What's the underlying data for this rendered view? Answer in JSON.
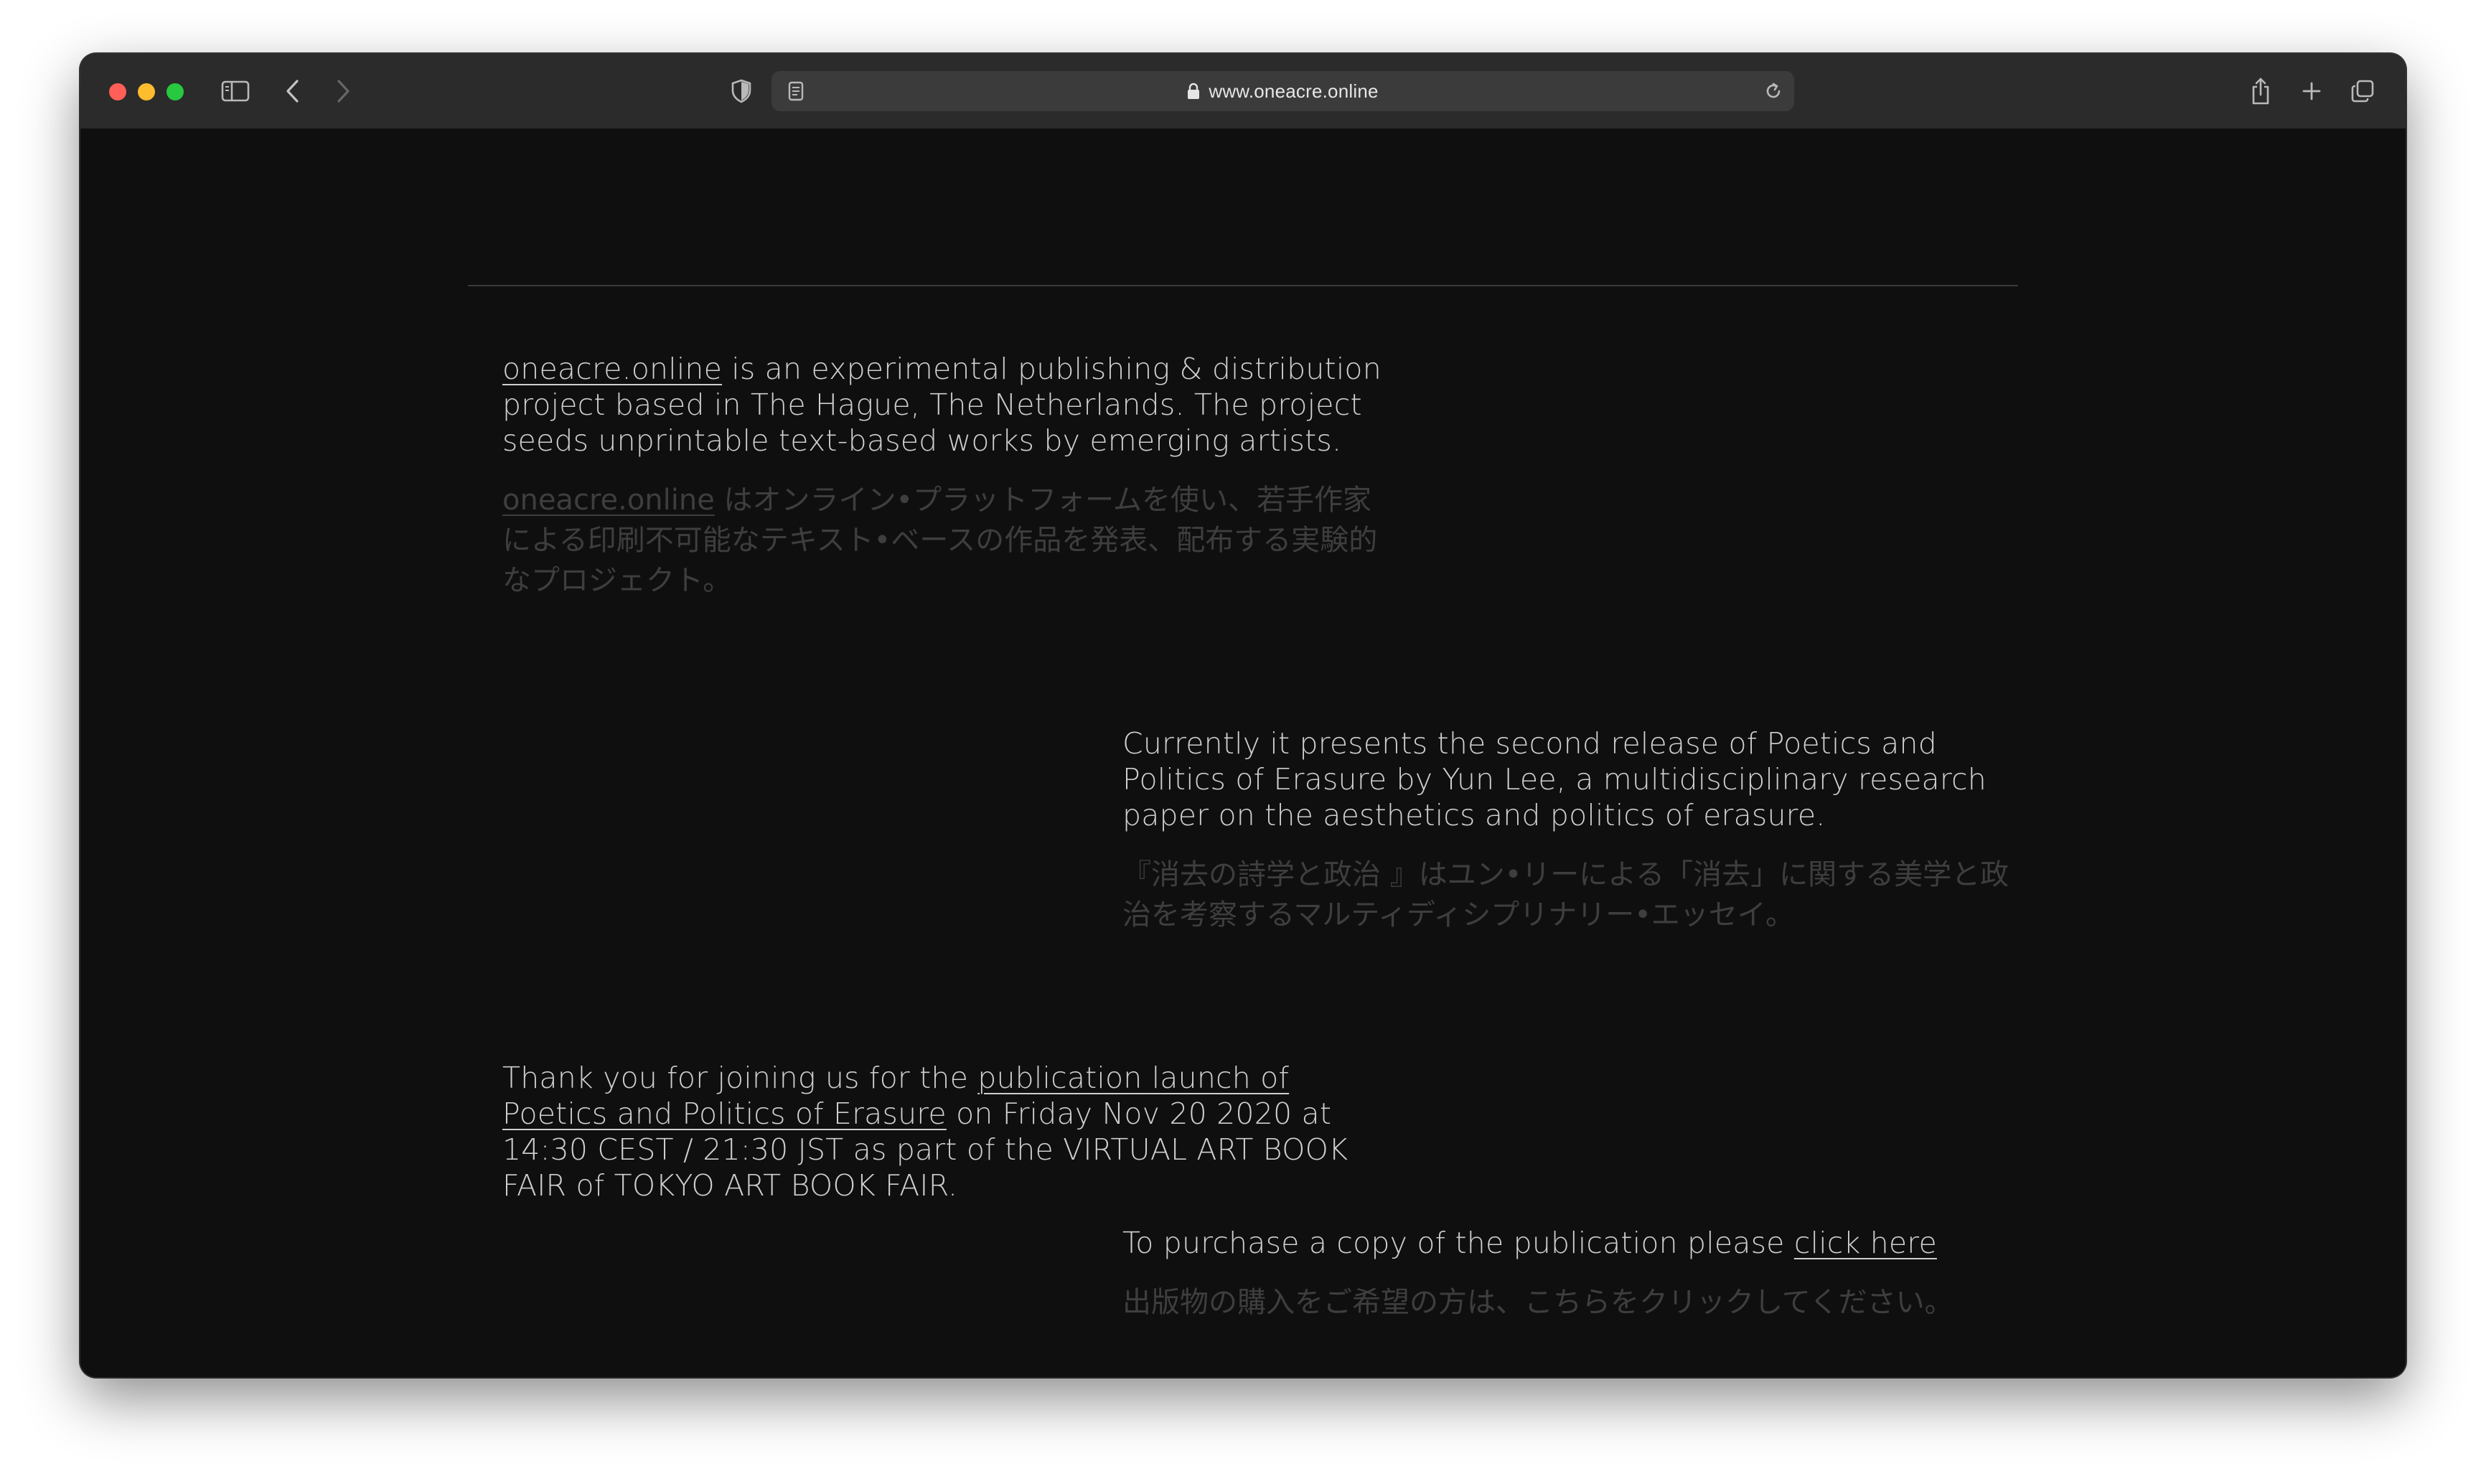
{
  "browser": {
    "url": "www.oneacre.online"
  },
  "intro": {
    "link": "oneacre.online",
    "text_en": " is an experimental publishing & distribution project based in The Hague, The Netherlands. The project seeds unprintable text-based works by emerging artists.",
    "link_jp": "oneacre.online",
    "text_jp": " はオンライン•プラットフォームを使い、若手作家による印刷不可能なテキスト•ベースの作品を発表、配布する実験的なプロジェクト。"
  },
  "current": {
    "text_en": "Currently it presents the second release of Poetics and Politics of Erasure by Yun Lee, a multidisciplinary research paper on the aesthetics and politics of erasure.",
    "text_jp": "『消去の詩学と政治 』はユン•リーによる「消去」に関する美学と政治を考察するマルティディシプリナリー•エッセイ。"
  },
  "launch": {
    "text_before": "Thank you for joining us for the ",
    "link": "publication launch of Poetics and Politics of Erasure",
    "text_after": " on Friday Nov 20 2020 at 14:30 CEST / 21:30 JST as part of the VIRTUAL ART BOOK FAIR of TOKYO ART BOOK FAIR."
  },
  "purchase": {
    "text_en": "To purchase a copy of the publication please ",
    "link": "click here",
    "text_jp": "出版物の購入をご希望の方は、こちらをクリックしてください。"
  },
  "colors": {
    "background": "#0f0f0f",
    "text": "#cfcfcf",
    "text_jp": "#3e3e3e",
    "toolbar": "#2b2b2b"
  }
}
